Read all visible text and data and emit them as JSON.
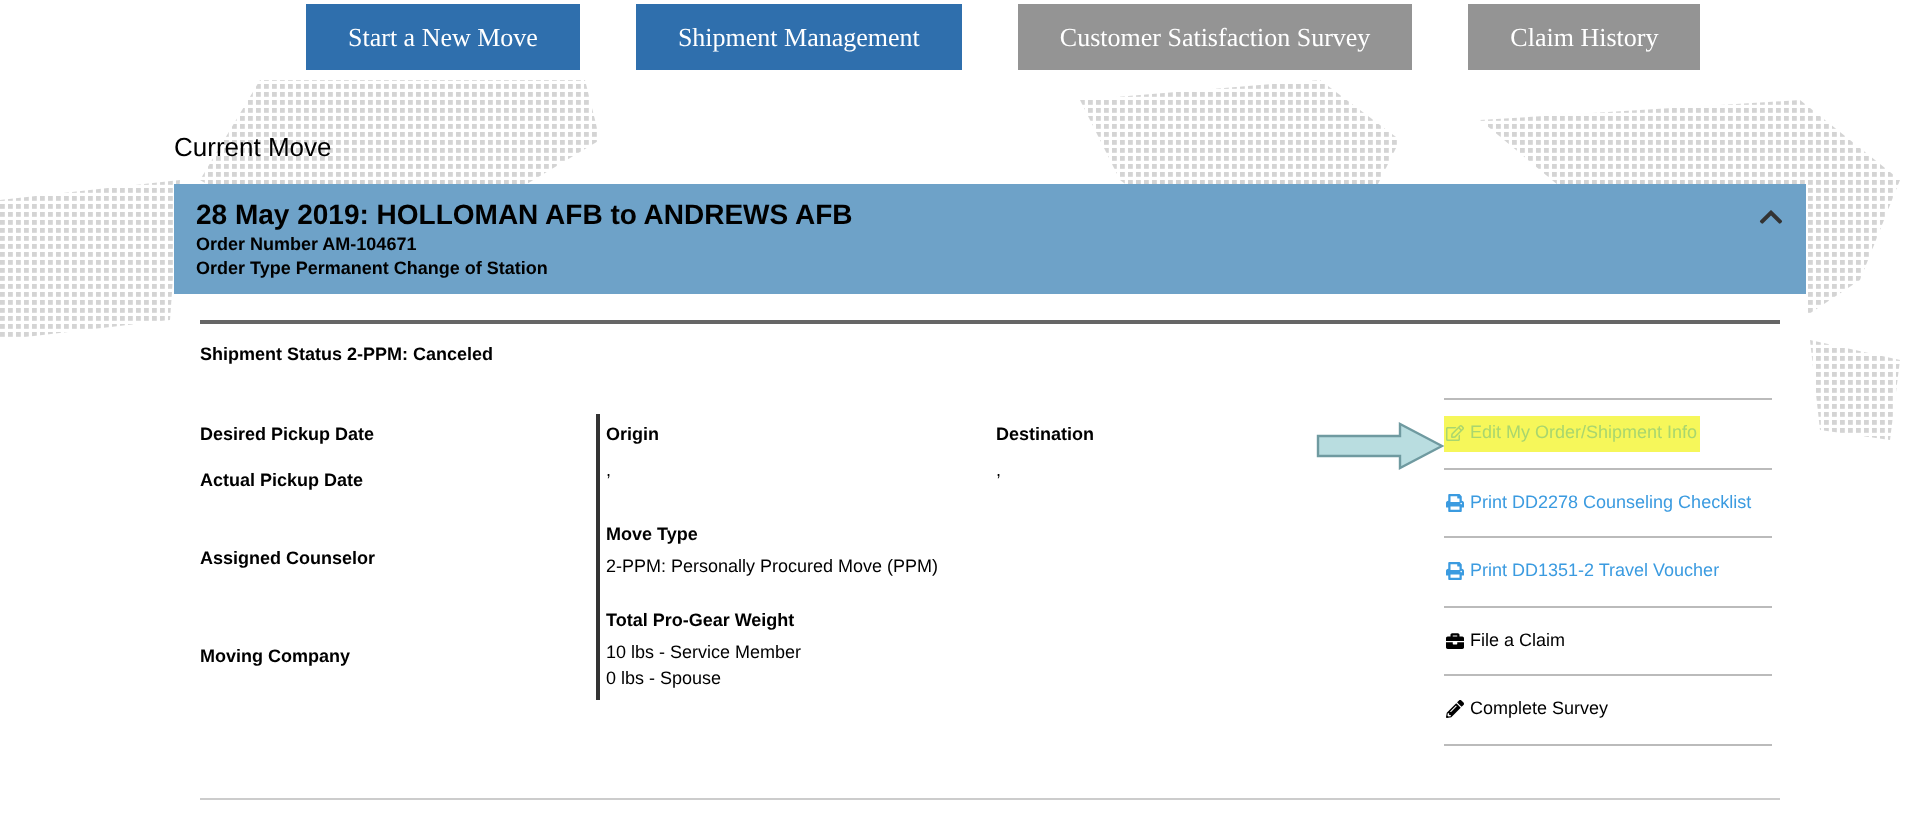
{
  "nav_buttons": [
    {
      "label": "Start a New Move",
      "disabled": false
    },
    {
      "label": "Shipment Management",
      "disabled": false
    },
    {
      "label": "Customer Satisfaction Survey",
      "disabled": true
    },
    {
      "label": "Claim History",
      "disabled": true
    }
  ],
  "section_title": "Current Move",
  "move": {
    "title": "28 May 2019: HOLLOMAN AFB to ANDREWS AFB",
    "order_number": "Order Number AM-104671",
    "order_type": "Order Type Permanent Change of Station",
    "expanded": true,
    "shipment_status": "Shipment Status 2-PPM: Canceled",
    "labels": [
      "Desired Pickup Date",
      "Actual Pickup Date",
      "Assigned Counselor",
      "Moving Company"
    ],
    "origin": {
      "heading": "Origin",
      "value": ","
    },
    "destination": {
      "heading": "Destination",
      "value": ","
    },
    "move_type": {
      "heading": "Move Type",
      "value": "2-PPM: Personally Procured Move (PPM)"
    },
    "pro_gear": {
      "heading": "Total Pro-Gear Weight",
      "values": [
        "10 lbs - Service Member",
        "0 lbs - Spouse"
      ]
    },
    "actions": [
      {
        "kind": "edit",
        "label": "Edit My Order/Shipment Info",
        "highlighted": true
      },
      {
        "kind": "print",
        "label": "Print DD2278 Counseling Checklist",
        "highlighted": false
      },
      {
        "kind": "print",
        "label": "Print DD1351-2 Travel Voucher",
        "highlighted": false
      },
      {
        "kind": "claim",
        "label": "File a Claim",
        "highlighted": false
      },
      {
        "kind": "survey",
        "label": "Complete Survey",
        "highlighted": false
      }
    ]
  }
}
